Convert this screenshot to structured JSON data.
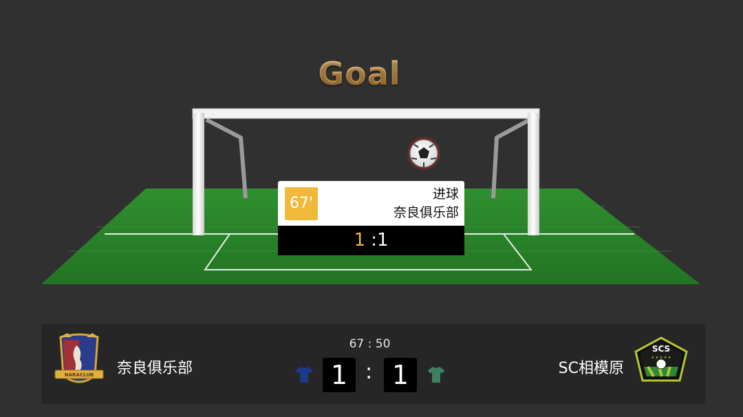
{
  "title": "Goal",
  "event_card": {
    "minute": "67'",
    "event_type": "进球",
    "team": "奈良俱乐部",
    "score_home": "1",
    "score_sep": " :",
    "score_away": "1"
  },
  "match": {
    "time": "67 : 50",
    "home": {
      "name": "奈良俱乐部",
      "score": "1",
      "logo_text": "NARACLUB",
      "jersey_color": "#1d3a8a"
    },
    "away": {
      "name": "SC相模原",
      "score": "1",
      "logo_text": "SCS",
      "jersey_color": "#3f7f63"
    },
    "colon": ":"
  },
  "colors": {
    "background": "#303030",
    "pitch": "#2e8a2e",
    "accent": "#f0b93a",
    "scorebar": "#262626"
  },
  "icons": [
    "soccer-ball-icon",
    "goal-frame",
    "home-jersey-icon",
    "away-jersey-icon"
  ]
}
